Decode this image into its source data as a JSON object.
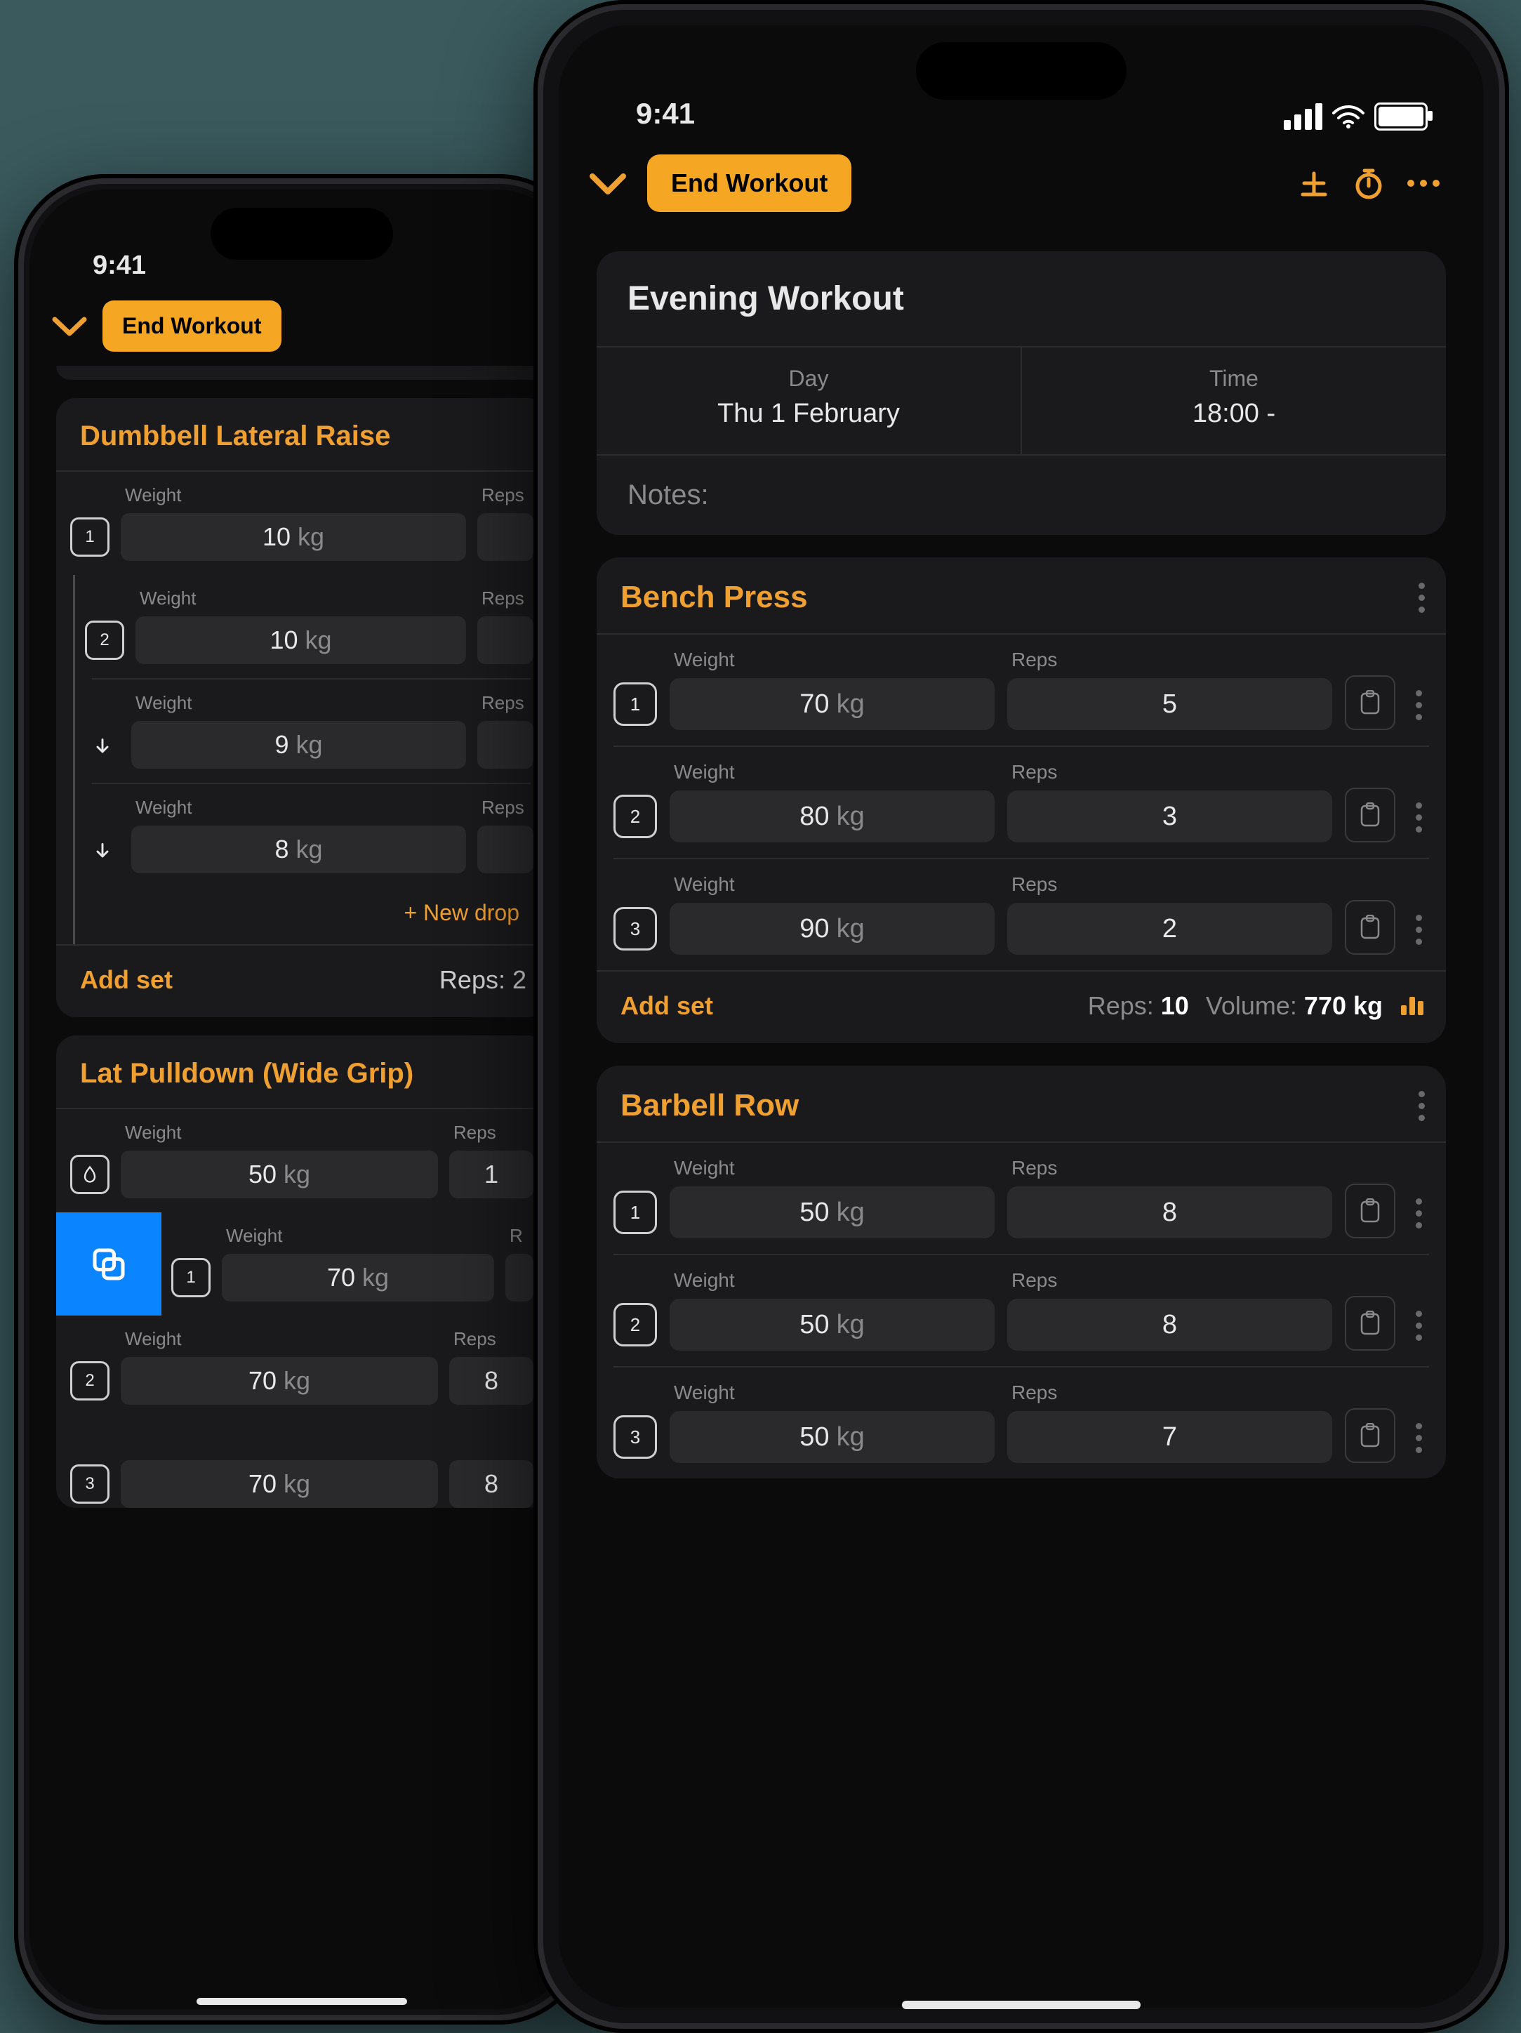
{
  "status": {
    "time": "9:41"
  },
  "nav": {
    "end_workout": "End Workout"
  },
  "front": {
    "workout_title": "Evening Workout",
    "day_label": "Day",
    "day_value": "Thu 1 February",
    "time_label": "Time",
    "time_value": "18:00 -",
    "notes_label": "Notes:",
    "exercises": [
      {
        "name": "Bench Press",
        "sets": [
          {
            "n": "1",
            "weight": "70",
            "unit": "kg",
            "reps": "5"
          },
          {
            "n": "2",
            "weight": "80",
            "unit": "kg",
            "reps": "3"
          },
          {
            "n": "3",
            "weight": "90",
            "unit": "kg",
            "reps": "2"
          }
        ],
        "footer": {
          "add": "Add set",
          "reps_label": "Reps:",
          "reps": "10",
          "vol_label": "Volume:",
          "vol": "770 kg"
        }
      },
      {
        "name": "Barbell Row",
        "sets": [
          {
            "n": "1",
            "weight": "50",
            "unit": "kg",
            "reps": "8"
          },
          {
            "n": "2",
            "weight": "50",
            "unit": "kg",
            "reps": "8"
          },
          {
            "n": "3",
            "weight": "50",
            "unit": "kg",
            "reps": "7"
          }
        ]
      }
    ]
  },
  "back": {
    "exercises": [
      {
        "name": "Dumbbell Lateral Raise",
        "sets": [
          {
            "badge": "1",
            "kind": "num",
            "weight": "10",
            "unit": "kg"
          }
        ],
        "drop_group": [
          {
            "badge": "2",
            "kind": "num",
            "weight": "10",
            "unit": "kg"
          },
          {
            "kind": "drop",
            "weight": "9",
            "unit": "kg"
          },
          {
            "kind": "drop",
            "weight": "8",
            "unit": "kg"
          }
        ],
        "new_drop": "+ New drop",
        "footer": {
          "add": "Add set",
          "reps_partial": "Reps: 2"
        }
      },
      {
        "name": "Lat Pulldown (Wide Grip)",
        "rows": [
          {
            "kind": "warm",
            "weight": "50",
            "unit": "kg",
            "reps_partial": "1"
          },
          {
            "kind": "swipe",
            "badge": "1",
            "weight": "70",
            "unit": "kg"
          },
          {
            "kind": "num",
            "badge": "2",
            "weight": "70",
            "unit": "kg",
            "reps_partial": "8"
          },
          {
            "kind": "num",
            "badge": "3",
            "weight": "70",
            "unit": "kg",
            "reps_partial": "8"
          }
        ]
      }
    ]
  },
  "labels": {
    "weight": "Weight",
    "reps": "Reps"
  }
}
